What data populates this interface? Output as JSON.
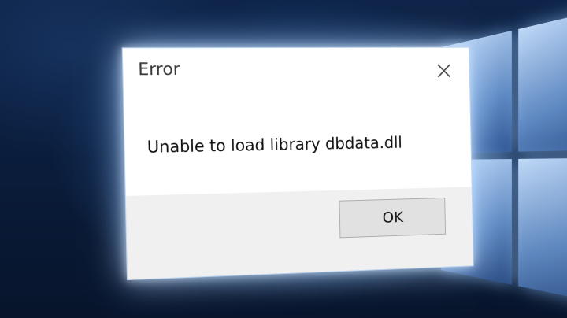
{
  "dialog": {
    "title": "Error",
    "message": "Unable to load library dbdata.dll",
    "ok_label": "OK",
    "close_icon": "close-icon"
  },
  "colors": {
    "dialog_bg": "#ffffff",
    "footer_bg": "#f0f0f0",
    "button_bg": "#e1e1e1",
    "button_border": "#adadad",
    "desktop_bg": "#0d2347"
  }
}
